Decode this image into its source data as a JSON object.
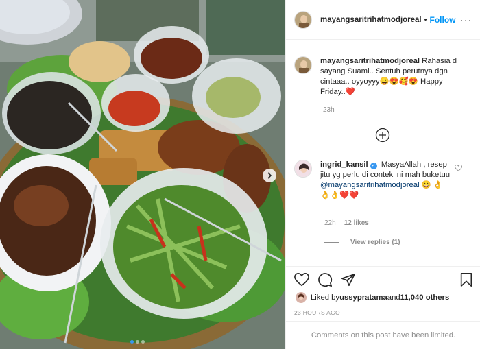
{
  "post": {
    "username": "mayangsaritrihatmodjoreal",
    "separator": "•",
    "follow_label": "Follow",
    "more_label": "···"
  },
  "caption": {
    "username": "mayangsaritrihatmodjoreal",
    "text": " Rahasia d sayang Suami.. Sentuh perutnya dgn cintaaa.. oyyoyyy😀😍🥰😍 Happy Friday..❤️",
    "time": "23h"
  },
  "comment": {
    "username": "ingrid_kansil",
    "verified_mark": "✓",
    "text_before": " MasyaAllah , resep jitu yg perlu di contek ini mah buketuu ",
    "mention": "@mayangsaritrihatmodjoreal",
    "text_after": " 😀 👌👌👌❤️❤️",
    "time": "22h",
    "likes": "12 likes",
    "view_replies": "View replies (1)"
  },
  "likes": {
    "prefix": "Liked by ",
    "user": "ussypratama",
    "middle": " and ",
    "count": "11,040 others"
  },
  "timestamp": "23 HOURS AGO",
  "comments_limited": "Comments on this post have been limited.",
  "colors": {
    "accent": "#0095f6",
    "verified": "#3897f0",
    "muted": "#8e8e8e",
    "border": "#efefef"
  },
  "icons": [
    "heart-icon",
    "comment-icon",
    "share-icon",
    "bookmark-icon",
    "add-comment-icon",
    "next-arrow-icon"
  ]
}
